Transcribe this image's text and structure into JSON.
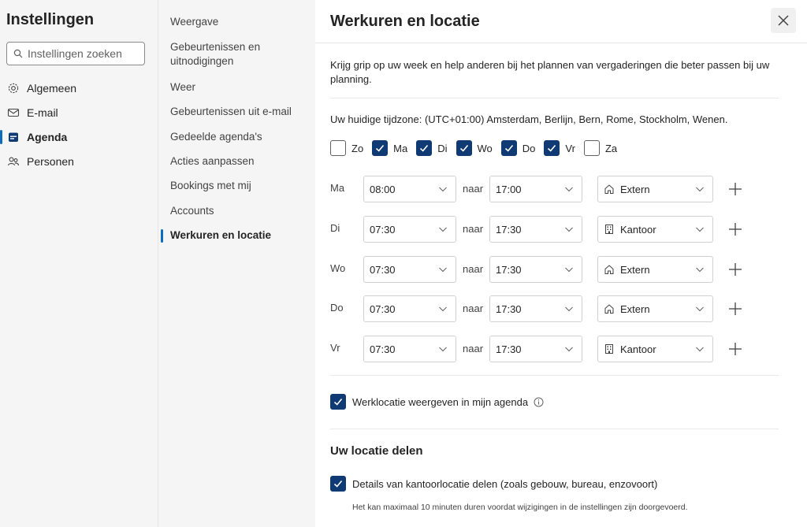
{
  "settings": {
    "title": "Instellingen",
    "search_placeholder": "Instellingen zoeken",
    "categories": [
      {
        "label": "Algemeen",
        "icon": "gear-icon"
      },
      {
        "label": "E-mail",
        "icon": "mail-icon"
      },
      {
        "label": "Agenda",
        "icon": "calendar-icon",
        "active": true
      },
      {
        "label": "Personen",
        "icon": "people-icon"
      }
    ]
  },
  "nav": {
    "items": [
      "Weergave",
      "Gebeurtenissen en uitnodigingen",
      "Weer",
      "Gebeurtenissen uit e-mail",
      "Gedeelde agenda's",
      "Acties aanpassen",
      "Bookings met mij",
      "Accounts",
      "Werkuren en locatie"
    ],
    "active_index": 8
  },
  "content": {
    "title": "Werkuren en locatie",
    "intro": "Krijg grip op uw week en help anderen bij het plannen van vergaderingen die beter passen bij uw planning.",
    "timezone": "Uw huidige tijdzone: (UTC+01:00) Amsterdam, Berlijn, Bern, Rome, Stockholm, Wenen.",
    "days": [
      {
        "label": "Zo",
        "checked": false
      },
      {
        "label": "Ma",
        "checked": true
      },
      {
        "label": "Di",
        "checked": true
      },
      {
        "label": "Wo",
        "checked": true
      },
      {
        "label": "Do",
        "checked": true
      },
      {
        "label": "Vr",
        "checked": true
      },
      {
        "label": "Za",
        "checked": false
      }
    ],
    "to_label": "naar",
    "rows": [
      {
        "day": "Ma",
        "start": "08:00",
        "end": "17:00",
        "location": "Extern",
        "loc_icon": "home-icon"
      },
      {
        "day": "Di",
        "start": "07:30",
        "end": "17:30",
        "location": "Kantoor",
        "loc_icon": "building-icon"
      },
      {
        "day": "Wo",
        "start": "07:30",
        "end": "17:30",
        "location": "Extern",
        "loc_icon": "home-icon"
      },
      {
        "day": "Do",
        "start": "07:30",
        "end": "17:30",
        "location": "Extern",
        "loc_icon": "home-icon"
      },
      {
        "day": "Vr",
        "start": "07:30",
        "end": "17:30",
        "location": "Kantoor",
        "loc_icon": "building-icon"
      }
    ],
    "show_location": {
      "label": "Werklocatie weergeven in mijn agenda",
      "checked": true
    },
    "share_section_title": "Uw locatie delen",
    "share_details": {
      "label": "Details van kantoorlocatie delen (zoals gebouw, bureau, enzovoort)",
      "checked": true
    },
    "note": "Het kan maximaal 10 minuten duren voordat wijzigingen in de instellingen zijn doorgevoerd."
  },
  "colors": {
    "accent": "#0f6cbd",
    "checkbox": "#0f3a73",
    "panel": "#f5f5f5"
  }
}
